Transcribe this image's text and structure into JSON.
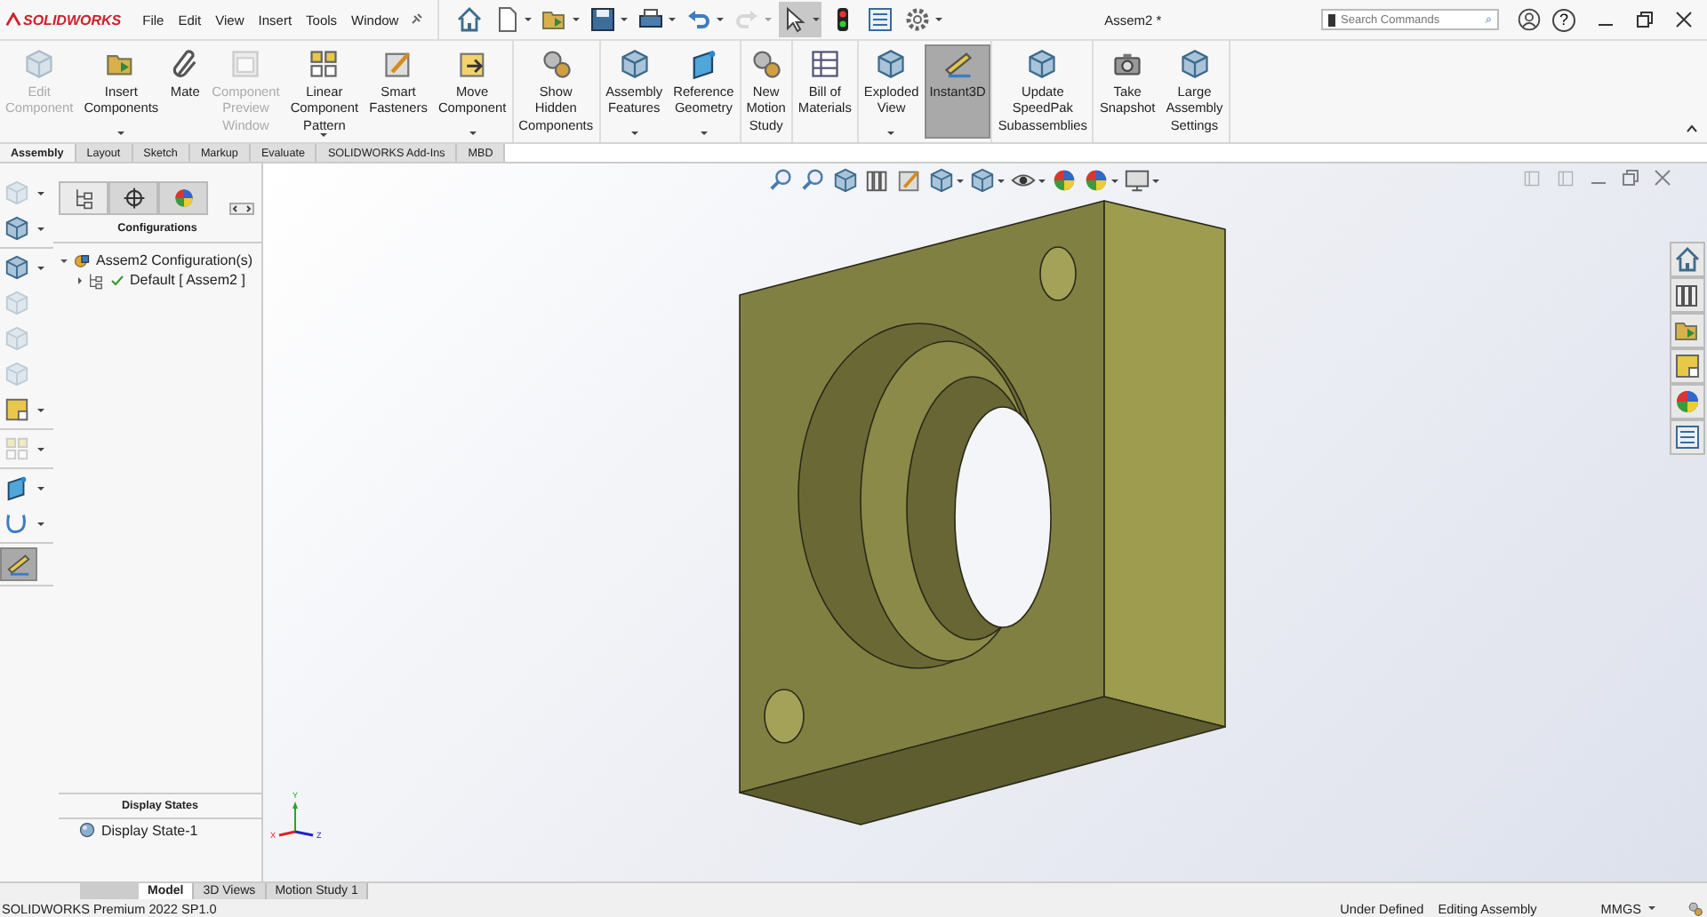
{
  "title_bar": {
    "logo": "SOLIDWORKS",
    "menu": [
      "File",
      "Edit",
      "View",
      "Insert",
      "Tools",
      "Window"
    ],
    "quick_access": [
      {
        "dropdown": false,
        "disabled": false,
        "selected": false
      },
      {
        "dropdown": true,
        "disabled": false,
        "selected": false
      },
      {
        "dropdown": true,
        "disabled": false,
        "selected": false
      },
      {
        "dropdown": true,
        "disabled": false,
        "selected": false
      },
      {
        "dropdown": true,
        "disabled": false,
        "selected": false
      },
      {
        "dropdown": true,
        "disabled": false,
        "selected": false
      },
      {
        "dropdown": true,
        "disabled": true,
        "selected": false
      },
      {
        "dropdown": true,
        "disabled": false,
        "selected": true
      },
      {
        "dropdown": false,
        "disabled": false,
        "selected": false
      },
      {
        "dropdown": false,
        "disabled": false,
        "selected": false
      },
      {
        "dropdown": true,
        "disabled": false,
        "selected": false
      }
    ],
    "title": "Assem2 *",
    "search": {
      "placeholder": "Search Commands"
    },
    "help": "?"
  },
  "ribbon": {
    "groups": [
      {
        "buttons": [
          {
            "label": "Edit\nComponent",
            "disabled": true,
            "dropdown": false,
            "selected": false
          },
          {
            "label": "Insert\nComponents",
            "disabled": false,
            "dropdown": true,
            "selected": false
          },
          {
            "label": "Mate",
            "disabled": false,
            "dropdown": false,
            "selected": false
          },
          {
            "label": "Component\nPreview\nWindow",
            "disabled": true,
            "dropdown": false,
            "selected": false
          },
          {
            "label": "Linear\nComponent\nPattern",
            "disabled": false,
            "dropdown": true,
            "selected": false
          },
          {
            "label": "Smart\nFasteners",
            "disabled": false,
            "dropdown": false,
            "selected": false
          },
          {
            "label": "Move\nComponent",
            "disabled": false,
            "dropdown": true,
            "selected": false
          }
        ]
      },
      {
        "buttons": [
          {
            "label": "Show\nHidden\nComponents",
            "disabled": false,
            "dropdown": false,
            "selected": false
          }
        ]
      },
      {
        "buttons": [
          {
            "label": "Assembly\nFeatures",
            "disabled": false,
            "dropdown": true,
            "selected": false
          },
          {
            "label": "Reference\nGeometry",
            "disabled": false,
            "dropdown": true,
            "selected": false
          }
        ]
      },
      {
        "buttons": [
          {
            "label": "New\nMotion\nStudy",
            "disabled": false,
            "dropdown": false,
            "selected": false
          }
        ]
      },
      {
        "buttons": [
          {
            "label": "Bill of\nMaterials",
            "disabled": false,
            "dropdown": false,
            "selected": false
          }
        ]
      },
      {
        "buttons": [
          {
            "label": "Exploded\nView",
            "disabled": false,
            "dropdown": true,
            "selected": false
          },
          {
            "label": "Instant3D",
            "disabled": false,
            "dropdown": false,
            "selected": true
          }
        ]
      },
      {
        "buttons": [
          {
            "label": "Update\nSpeedPak\nSubassemblies",
            "disabled": false,
            "dropdown": false,
            "selected": false
          }
        ]
      },
      {
        "buttons": [
          {
            "label": "Take\nSnapshot",
            "disabled": false,
            "dropdown": false,
            "selected": false
          },
          {
            "label": "Large\nAssembly\nSettings",
            "disabled": false,
            "dropdown": false,
            "selected": false
          }
        ]
      }
    ]
  },
  "tabs": [
    {
      "label": "Assembly",
      "selected": true
    },
    {
      "label": "Layout",
      "selected": false
    },
    {
      "label": "Sketch",
      "selected": false
    },
    {
      "label": "Markup",
      "selected": false
    },
    {
      "label": "Evaluate",
      "selected": false
    },
    {
      "label": "SOLIDWORKS Add-Ins",
      "selected": false
    },
    {
      "label": "MBD",
      "selected": false
    }
  ],
  "left_toolbar": {
    "groups": [
      [
        {
          "disabled": true,
          "dropdown": true,
          "selected": false
        },
        {
          "disabled": false,
          "dropdown": true,
          "selected": false
        }
      ],
      [
        {
          "disabled": false,
          "dropdown": true,
          "selected": false
        },
        {
          "disabled": true,
          "dropdown": false,
          "selected": false
        },
        {
          "disabled": true,
          "dropdown": false,
          "selected": false
        },
        {
          "disabled": true,
          "dropdown": false,
          "selected": false
        },
        {
          "disabled": false,
          "dropdown": true,
          "selected": false
        }
      ],
      [
        {
          "disabled": true,
          "dropdown": true,
          "selected": false
        }
      ],
      [
        {
          "disabled": false,
          "dropdown": true,
          "selected": false
        },
        {
          "disabled": false,
          "dropdown": true,
          "selected": false
        }
      ],
      [
        {
          "disabled": false,
          "dropdown": false,
          "selected": true
        }
      ]
    ]
  },
  "panel": {
    "tabs": [
      {
        "selected": true
      },
      {
        "selected": false
      },
      {
        "selected": false
      }
    ],
    "heading": "Configurations",
    "tree": [
      {
        "label": "Assem2 Configuration(s)",
        "expanded": true,
        "active": false,
        "children": [
          {
            "label": "Default [ Assem2 ]",
            "expanded": false,
            "active": true
          }
        ]
      }
    ],
    "display_states": {
      "heading": "Display States",
      "items": [
        "Display State-1"
      ]
    }
  },
  "viewport": {
    "heads_up_toolbar": [
      {
        "dropdown": false
      },
      {
        "dropdown": false
      },
      {
        "dropdown": false
      },
      {
        "dropdown": false
      },
      {
        "dropdown": false
      },
      {
        "dropdown": true
      },
      {
        "dropdown": true
      },
      {
        "dropdown": true
      },
      {
        "dropdown": false
      },
      {
        "dropdown": true
      },
      {
        "dropdown": true
      }
    ],
    "axes": [
      "Y",
      "X",
      "Z"
    ]
  },
  "bottom_tabs": [
    {
      "label": "Model",
      "selected": true
    },
    {
      "label": "3D Views",
      "selected": false
    },
    {
      "label": "Motion Study 1",
      "selected": false
    }
  ],
  "status_bar": {
    "product": "SOLIDWORKS Premium 2022 SP1.0",
    "state": "Under Defined",
    "mode": "Editing Assembly",
    "units": "MMGS"
  }
}
